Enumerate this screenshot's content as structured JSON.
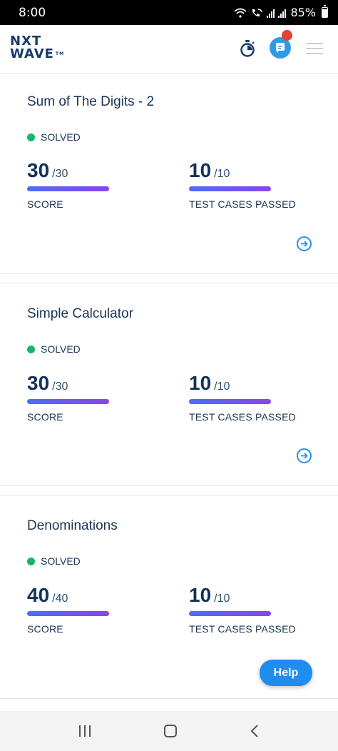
{
  "status_bar": {
    "time": "8:00",
    "battery": "85%"
  },
  "header": {
    "logo_line1": "NXT",
    "logo_line2": "WAVE",
    "logo_tm": "TM"
  },
  "problems": [
    {
      "title": "Sum of The Digits - 2",
      "status": "SOLVED",
      "score": "30",
      "score_total": "/30",
      "score_label": "SCORE",
      "tests": "10",
      "tests_total": "/10",
      "tests_label": "TEST CASES PASSED"
    },
    {
      "title": "Simple Calculator",
      "status": "SOLVED",
      "score": "30",
      "score_total": "/30",
      "score_label": "SCORE",
      "tests": "10",
      "tests_total": "/10",
      "tests_label": "TEST CASES PASSED"
    },
    {
      "title": "Denominations",
      "status": "SOLVED",
      "score": "40",
      "score_total": "/40",
      "score_label": "SCORE",
      "tests": "10",
      "tests_total": "/10",
      "tests_label": "TEST CASES PASSED"
    }
  ],
  "help_label": "Help",
  "colors": {
    "accent": "#2d8fe6",
    "solved": "#12b76a",
    "progress_start": "#4c6ef5",
    "progress_end": "#8b45e6",
    "notification": "#e0432f"
  }
}
